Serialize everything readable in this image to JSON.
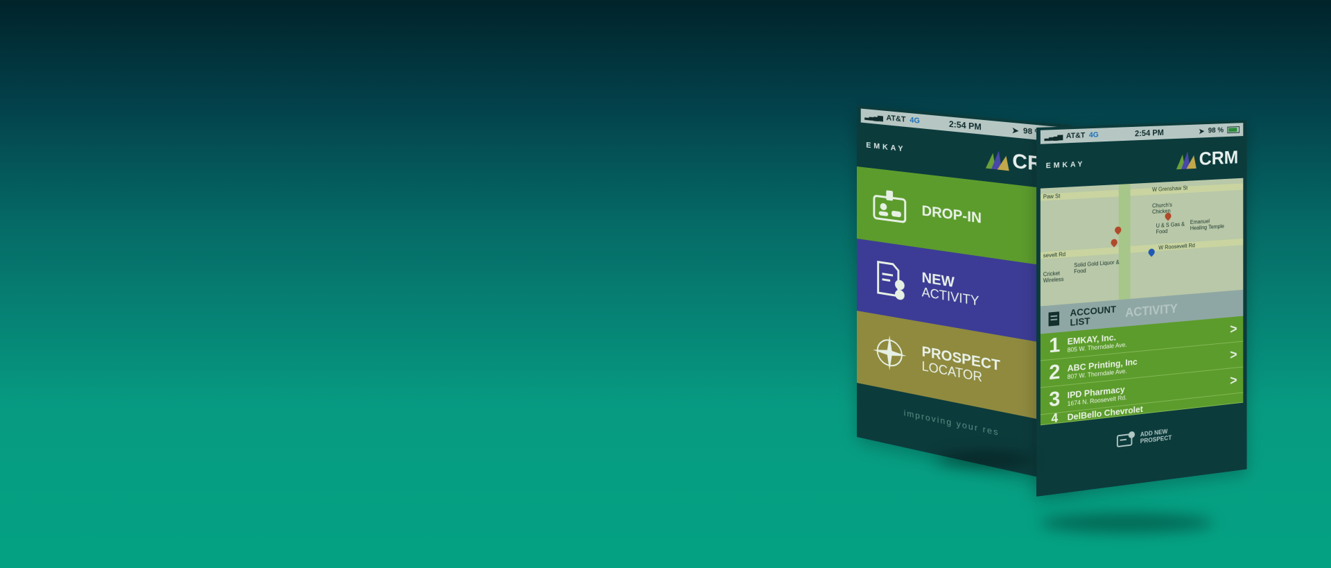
{
  "phone1": {
    "status": {
      "carrier": "AT&T",
      "network": "4G",
      "time": "2:54 PM",
      "battery": "98 %"
    },
    "brand": {
      "left": "EMKAY",
      "logo": "CRM"
    },
    "tiles": [
      {
        "line1": "DROP-IN",
        "line2": "",
        "icon": "visitor-badge-icon",
        "color": "#5c9c2c"
      },
      {
        "line1": "NEW",
        "line2": "ACTIVITY",
        "icon": "checklist-icon",
        "color": "#3c3c96"
      },
      {
        "line1": "PROSPECT",
        "line2": "LOCATOR",
        "icon": "compass-icon",
        "color": "#8f8a3e"
      }
    ],
    "footer": "improving your res"
  },
  "phone2": {
    "status": {
      "carrier": "AT&T",
      "network": "4G",
      "time": "2:54 PM",
      "battery": "98 %"
    },
    "brand": {
      "left": "EMKAY",
      "logo": "CRM"
    },
    "map_labels": {
      "street1": "W Grenshaw St",
      "street2": "sevelt Rd",
      "street3": "W Roosevelt Rd",
      "poi1": "Church's Chicken",
      "poi2": "Emanuel Healing Temple",
      "poi3": "Solid Gold Liquor & Food",
      "poi4": "Cricket Wireless",
      "poi5": "U & S Gas & Food",
      "street4": "Paw St"
    },
    "tabs": {
      "active_line1": "ACCOUNT",
      "active_line2": "LIST",
      "inactive": "ACTIVITY"
    },
    "accounts": [
      {
        "num": "1",
        "name": "EMKAY, Inc.",
        "addr": "805 W. Thorndale Ave."
      },
      {
        "num": "2",
        "name": "ABC Printing, Inc",
        "addr": "807 W. Thorndale Ave."
      },
      {
        "num": "3",
        "name": "IPD Pharmacy",
        "addr": "1674 N. Roosevelt Rd."
      },
      {
        "num": "4",
        "name": "DelBello Chevrolet",
        "addr": ""
      }
    ],
    "add_prospect": {
      "line1": "ADD NEW",
      "line2": "PROSPECT"
    }
  },
  "colors": {
    "background_top": "#01232a",
    "background_bottom": "#04a283",
    "accent_green": "#5c9c2c",
    "accent_purple": "#3c3c96",
    "accent_gold": "#8f8a3e"
  }
}
